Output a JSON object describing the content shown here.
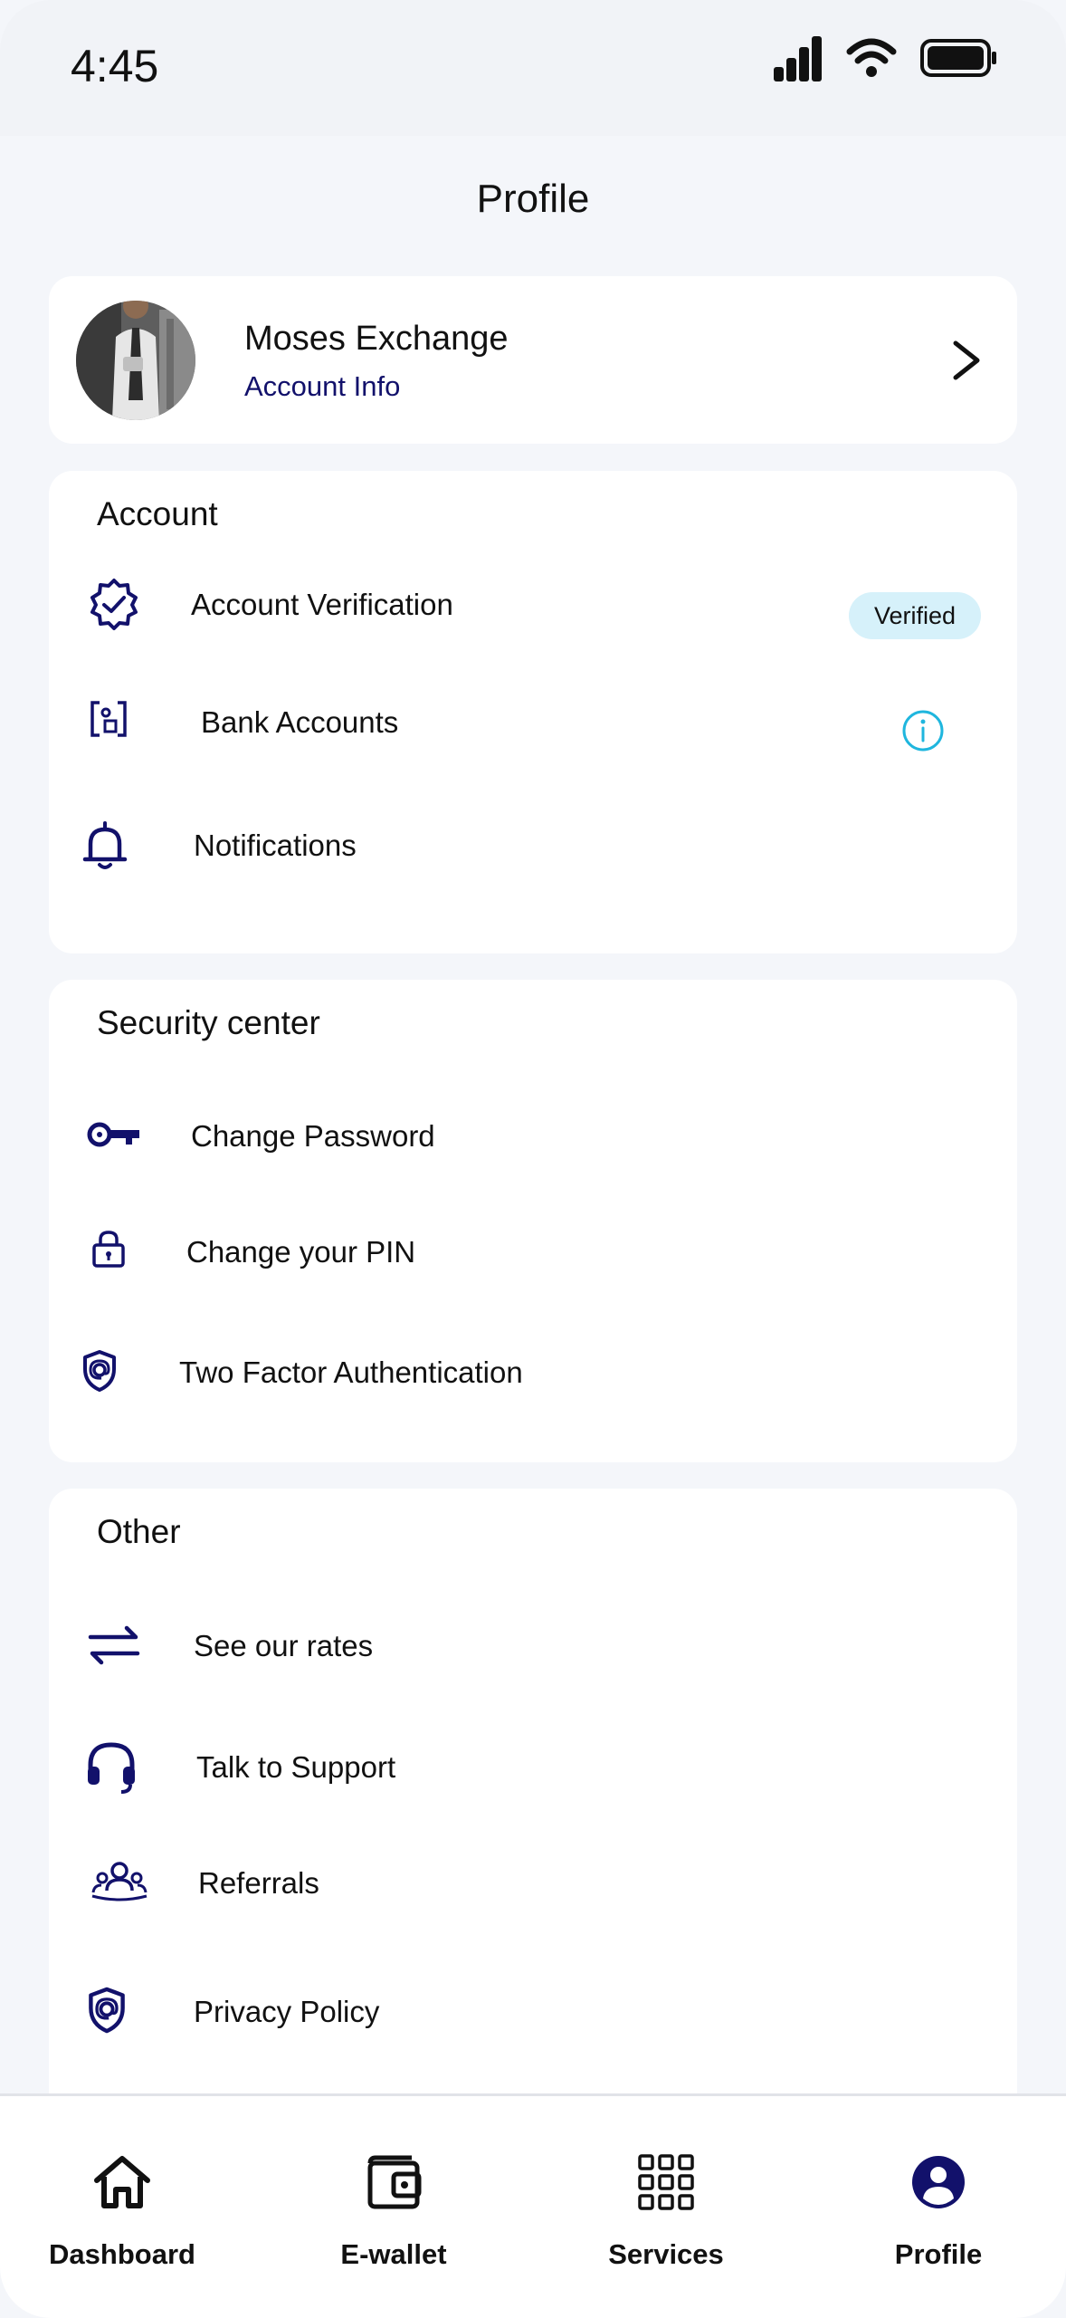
{
  "status_bar": {
    "time": "4:45"
  },
  "header": {
    "title": "Profile"
  },
  "profile": {
    "name": "Moses Exchange",
    "subtitle": "Account Info"
  },
  "account": {
    "title": "Account",
    "items": [
      {
        "label": "Account Verification",
        "icon": "verified-badge-icon",
        "badge": "Verified"
      },
      {
        "label": "Bank Accounts",
        "icon": "bank-accounts-icon",
        "trailing_icon": "info-icon"
      },
      {
        "label": "Notifications",
        "icon": "bell-icon"
      }
    ]
  },
  "security": {
    "title": "Security center",
    "items": [
      {
        "label": "Change Password",
        "icon": "key-icon"
      },
      {
        "label": "Change your PIN",
        "icon": "lock-icon"
      },
      {
        "label": "Two Factor Authentication",
        "icon": "shield-at-icon"
      }
    ]
  },
  "other": {
    "title": "Other",
    "items": [
      {
        "label": "See our rates",
        "icon": "exchange-arrows-icon"
      },
      {
        "label": "Talk to Support",
        "icon": "headset-icon"
      },
      {
        "label": "Referrals",
        "icon": "users-icon"
      },
      {
        "label": "Privacy Policy",
        "icon": "shield-at-icon"
      }
    ]
  },
  "bottom_nav": {
    "items": [
      {
        "label": "Dashboard",
        "icon": "home-icon"
      },
      {
        "label": "E-wallet",
        "icon": "wallet-icon"
      },
      {
        "label": "Services",
        "icon": "grid-icon"
      },
      {
        "label": "Profile",
        "icon": "profile-icon",
        "active": true
      }
    ]
  },
  "colors": {
    "accent": "#12116B",
    "info": "#1FB6DE",
    "badge_bg": "#D6F1FA",
    "background": "#F4F6FA"
  }
}
